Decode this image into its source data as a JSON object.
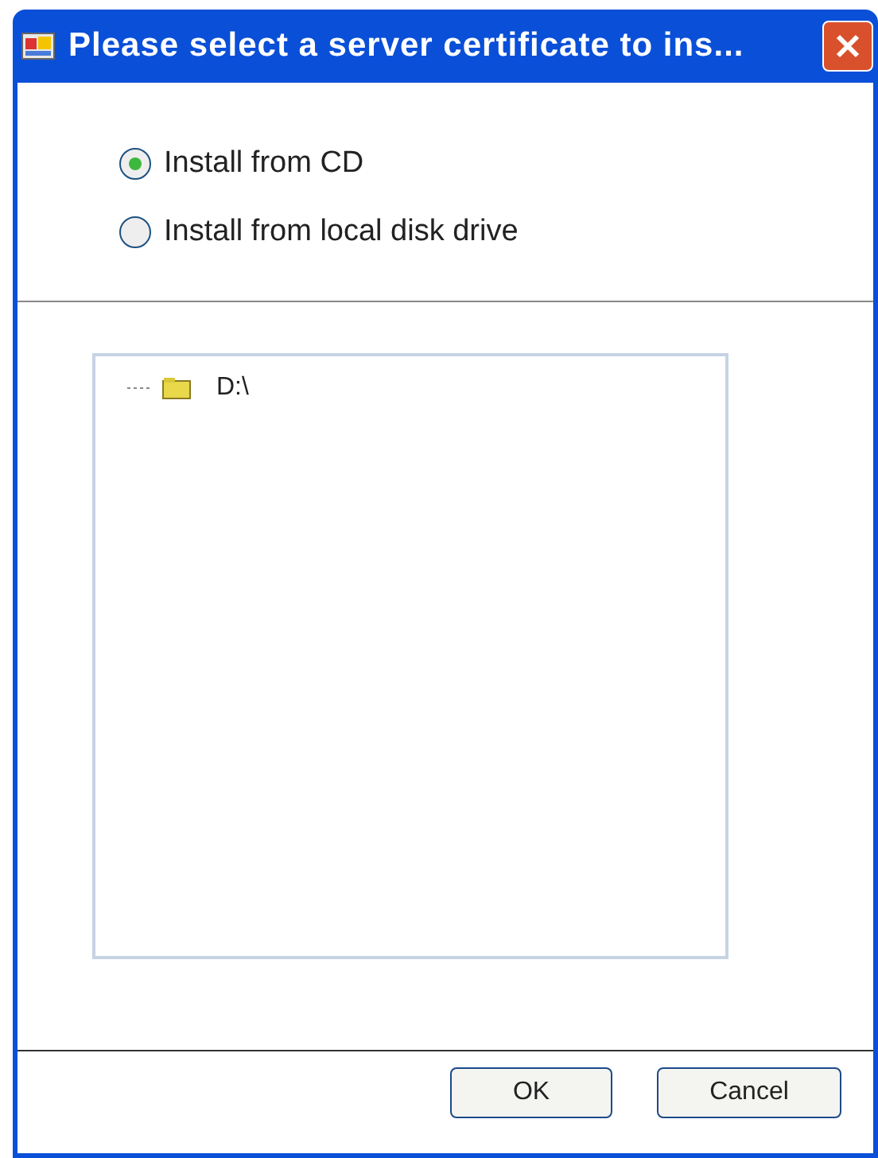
{
  "window": {
    "title": "Please select a server certificate to ins..."
  },
  "options": [
    {
      "label": "Install from CD",
      "selected": true
    },
    {
      "label": "Install from local disk drive",
      "selected": false
    }
  ],
  "tree": {
    "items": [
      {
        "label": "D:\\"
      }
    ]
  },
  "buttons": [
    "OK",
    "Cancel"
  ]
}
